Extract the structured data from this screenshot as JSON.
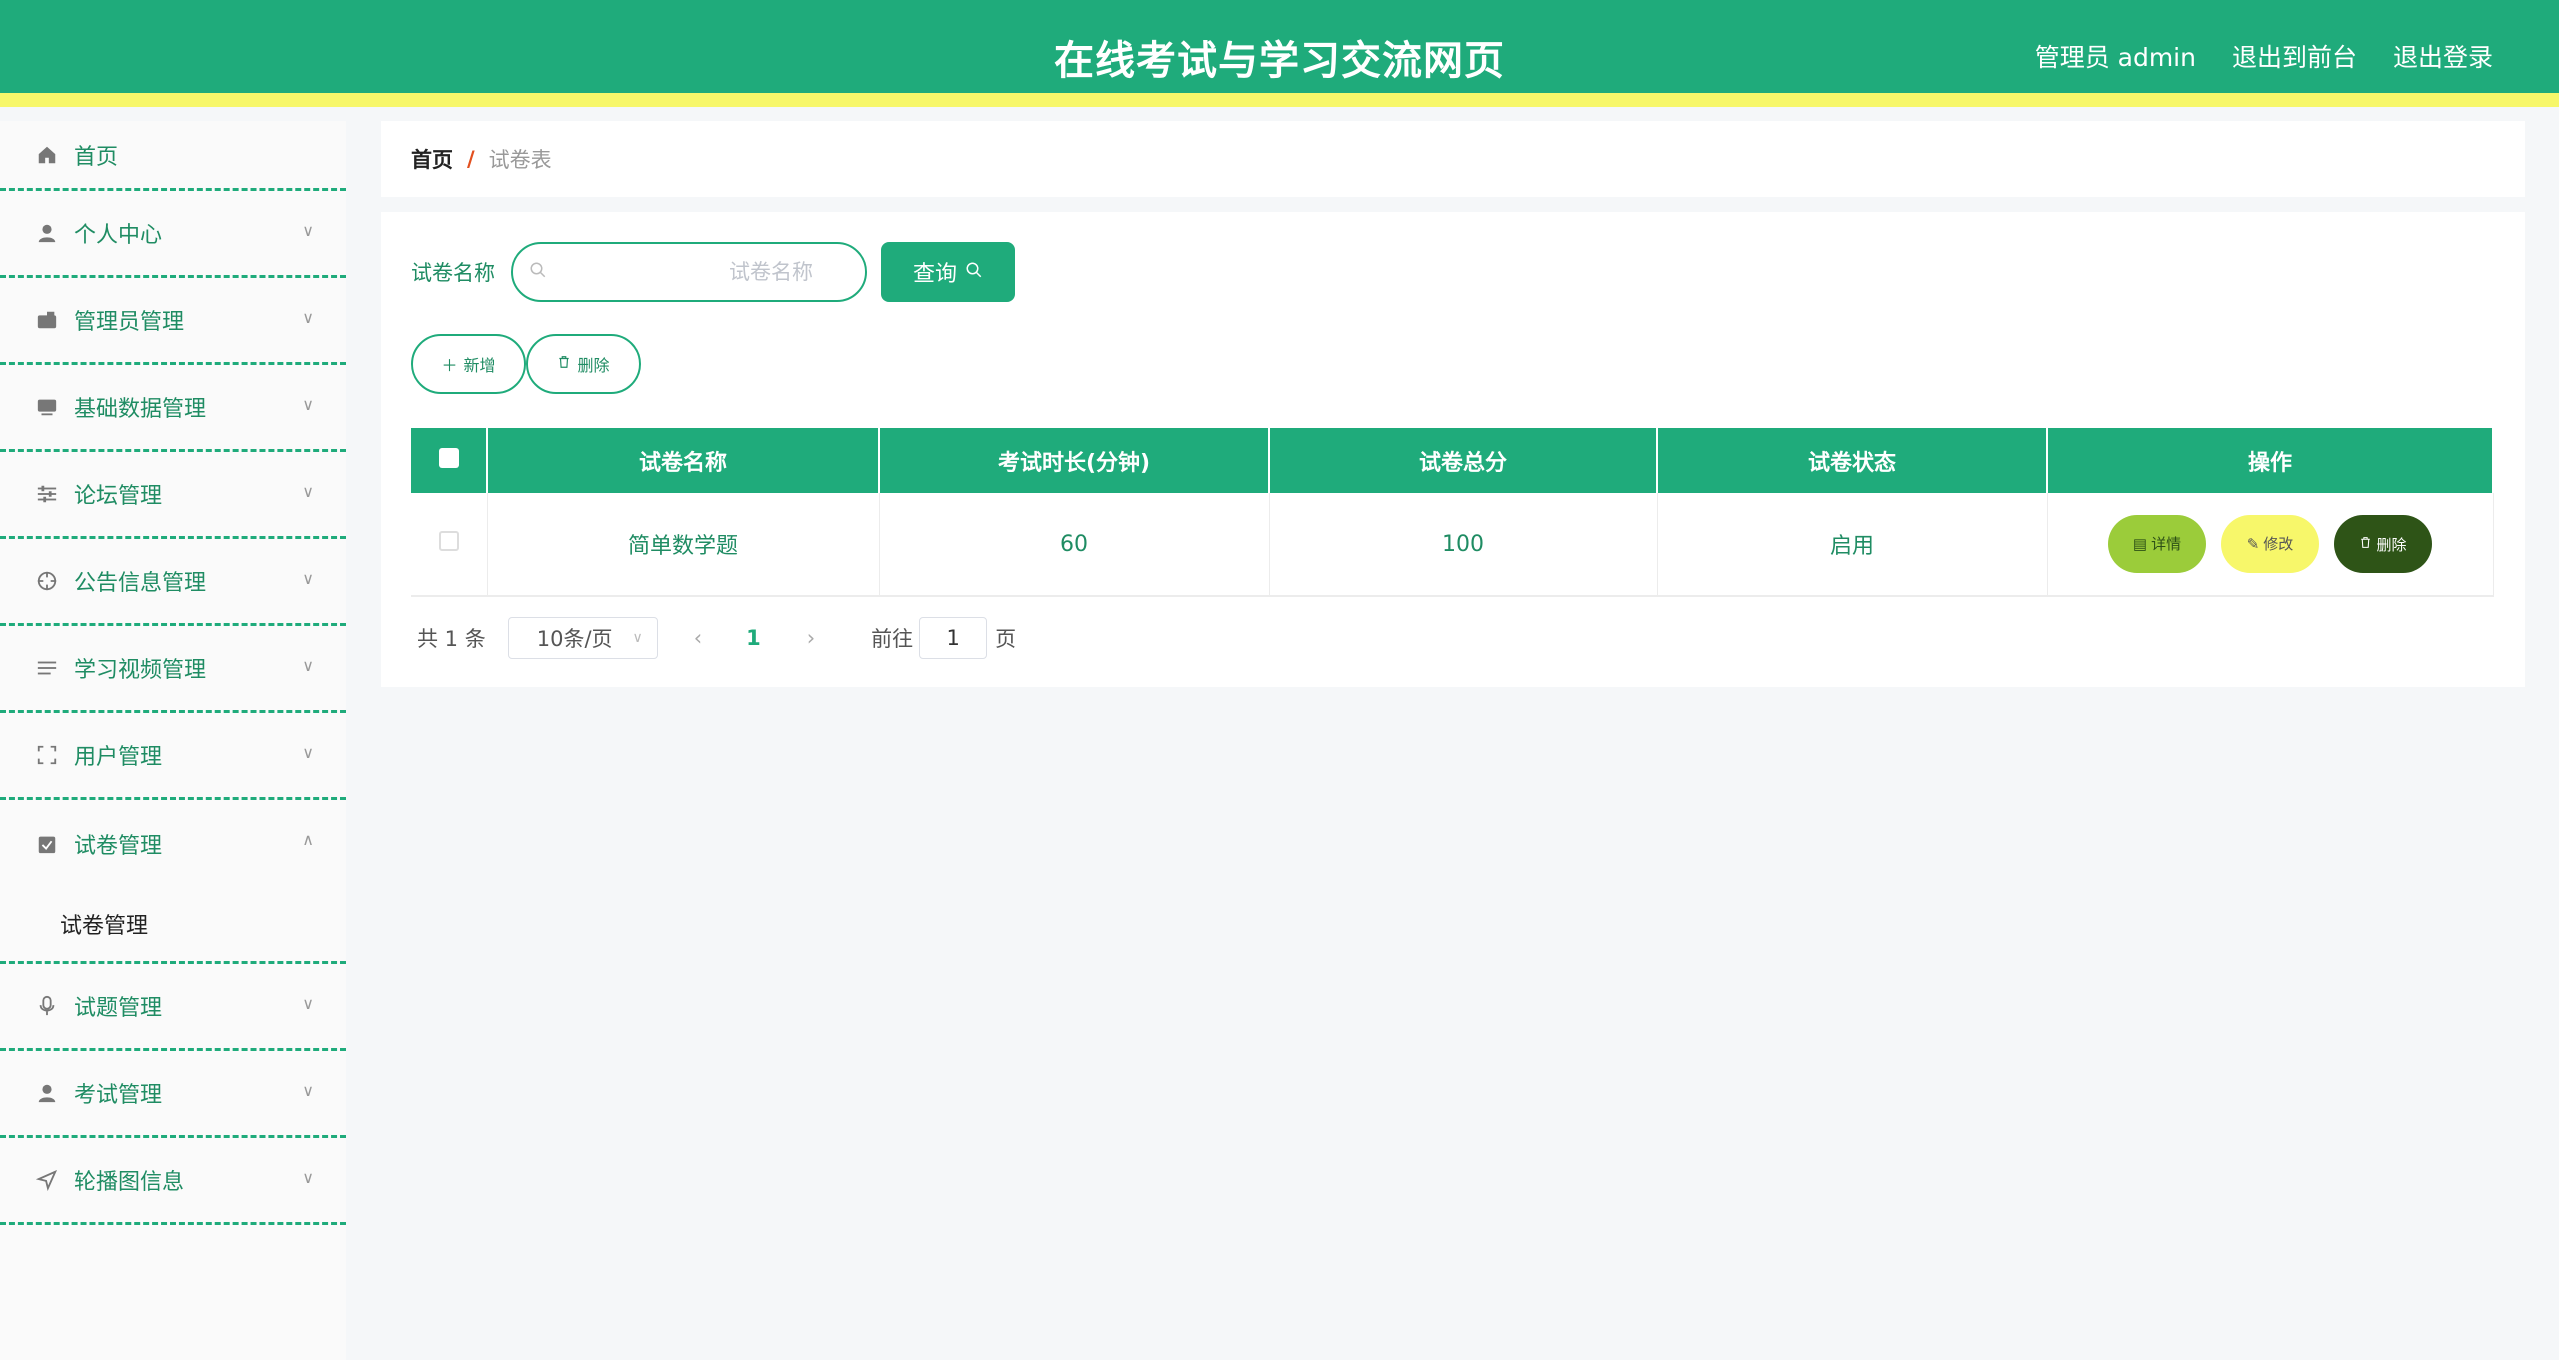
{
  "header": {
    "title": "在线考试与学习交流网页",
    "user_label": "管理员 admin",
    "to_front": "退出到前台",
    "logout": "退出登录"
  },
  "sidebar": {
    "items": [
      {
        "label": "首页",
        "icon": "home-icon"
      },
      {
        "label": "个人中心",
        "icon": "user-icon"
      },
      {
        "label": "管理员管理",
        "icon": "wallet-icon"
      },
      {
        "label": "基础数据管理",
        "icon": "monitor-icon"
      },
      {
        "label": "论坛管理",
        "icon": "sliders-icon"
      },
      {
        "label": "公告信息管理",
        "icon": "crosshair-icon"
      },
      {
        "label": "学习视频管理",
        "icon": "list-icon"
      },
      {
        "label": "用户管理",
        "icon": "fullscreen-icon"
      },
      {
        "label": "试卷管理",
        "icon": "clipboard-icon"
      },
      {
        "label": "试题管理",
        "icon": "microphone-icon"
      },
      {
        "label": "考试管理",
        "icon": "user-icon"
      },
      {
        "label": "轮播图信息",
        "icon": "send-icon"
      }
    ],
    "sub_open": "试卷管理"
  },
  "breadcrumb": {
    "home": "首页",
    "separator": "/",
    "current": "试卷表"
  },
  "search": {
    "label": "试卷名称",
    "placeholder": "试卷名称",
    "button": "查询"
  },
  "actions": {
    "add": "新增",
    "delete": "删除"
  },
  "table": {
    "columns": [
      "试卷名称",
      "考试时长(分钟)",
      "试卷总分",
      "试卷状态",
      "操作"
    ],
    "rows": [
      {
        "name": "简单数学题",
        "duration": "60",
        "score": "100",
        "status": "启用"
      }
    ],
    "ops": {
      "detail": "详情",
      "edit": "修改",
      "delete": "删除"
    }
  },
  "pager": {
    "total": "共 1 条",
    "page_size": "10条/页",
    "current_page": "1",
    "goto_label": "前往",
    "goto_value": "1",
    "goto_unit": "页"
  },
  "colors": {
    "primary": "#1fab7b",
    "accent_yellow": "#f7f76a",
    "detail": "#9bcc3a",
    "danger": "#2e5417"
  }
}
